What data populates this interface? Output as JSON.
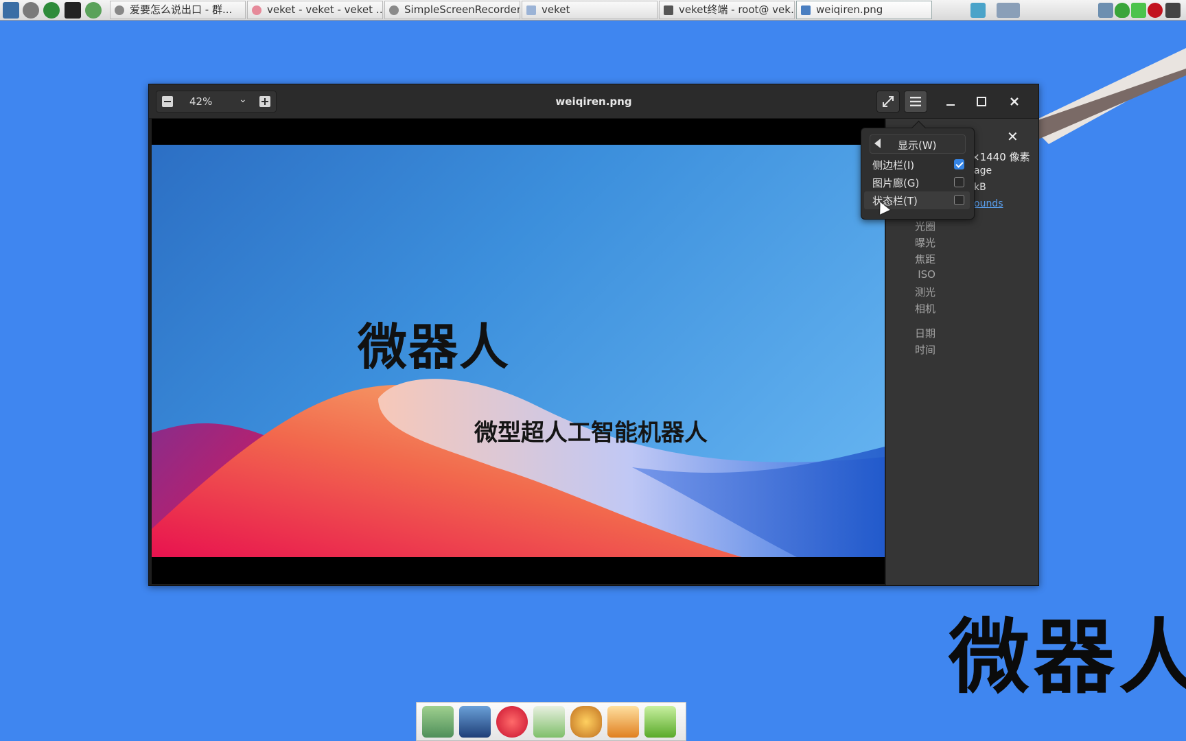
{
  "taskbar": {
    "launchers": [
      "system-monitor-icon",
      "settings-icon",
      "media-play-icon",
      "terminal-icon",
      "browser-icon"
    ],
    "tasks": [
      {
        "label": "爱要怎么说出口 - 群...",
        "icon": "chrome-icon",
        "active": false
      },
      {
        "label": "veket - veket - veket …",
        "icon": "firefox-icon",
        "active": false
      },
      {
        "label": "SimpleScreenRecorder",
        "icon": "recorder-icon",
        "active": false
      },
      {
        "label": "veket",
        "icon": "folder-icon",
        "active": false
      },
      {
        "label": "veket终端 - root@ vek…",
        "icon": "terminal-icon",
        "active": false
      },
      {
        "label": "weiqiren.png",
        "icon": "image-icon",
        "active": true
      }
    ],
    "tray": [
      "network-icon",
      "shield-icon",
      "battery-icon",
      "record-icon",
      "keyboard-icon"
    ]
  },
  "viewer": {
    "title": "weiqiren.png",
    "zoom": "42%",
    "image": {
      "title": "微器人",
      "subtitle": "微型超人工智能机器人"
    },
    "sidebar": {
      "close": "✕",
      "fragments": {
        "size": "×1440 像素",
        "type": "age",
        "filesize": "kB",
        "folder": "ounds"
      },
      "labels": [
        "光圈",
        "曝光",
        "焦距",
        "ISO",
        "测光",
        "相机",
        "日期",
        "时间"
      ]
    },
    "menu": {
      "header": "显示(W)",
      "items": [
        {
          "label": "侧边栏(I)",
          "checked": true
        },
        {
          "label": "图片廊(G)",
          "checked": false
        },
        {
          "label": "状态栏(T)",
          "checked": false
        }
      ]
    }
  },
  "desktop": {
    "big_text": "微器人"
  },
  "dock": {
    "items": [
      "file-manager-icon",
      "monitor-icon",
      "pet-app-icon",
      "notepad-icon",
      "paint-icon",
      "game-icon",
      "help-icon"
    ]
  },
  "colors": {
    "desktop": "#3f86f0",
    "accent": "#3584e4",
    "headerbar": "#2b2b2b"
  }
}
